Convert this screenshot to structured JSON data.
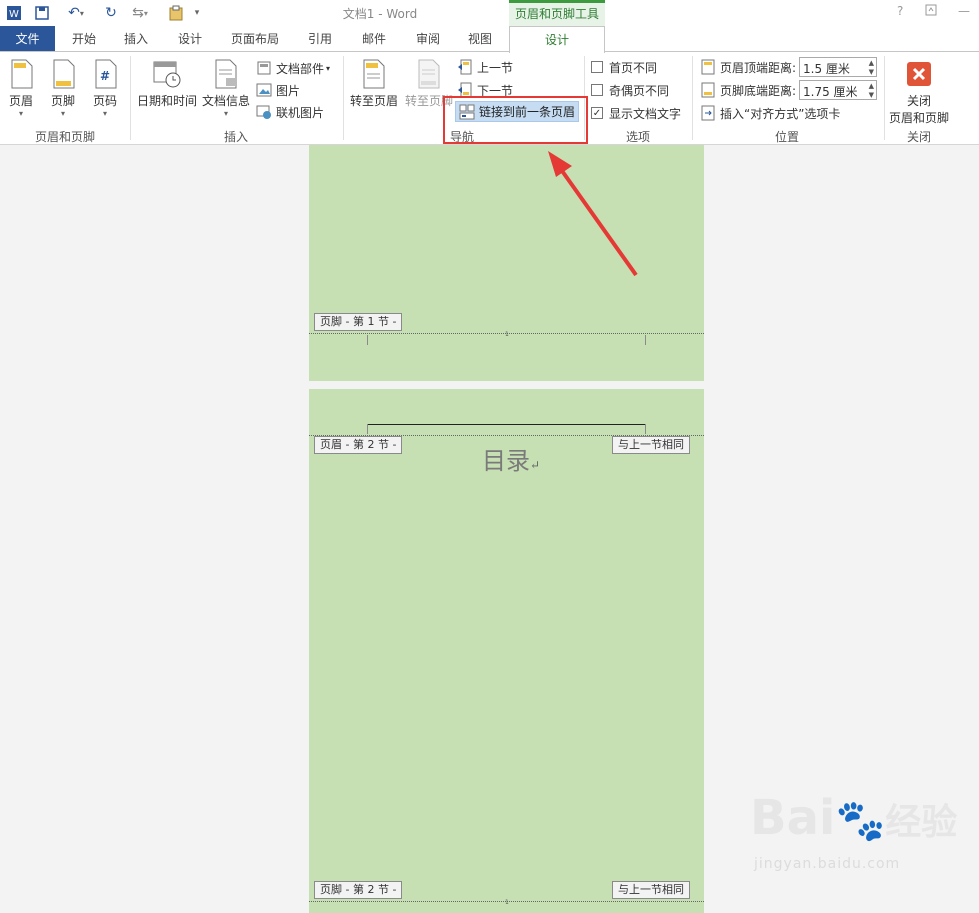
{
  "window": {
    "title": "文档1 - Word",
    "context_tab_group": "页眉和页脚工具",
    "help": "?",
    "accent_color": "#2b579a",
    "context_color": "#2e7d32"
  },
  "tabs": [
    "文件",
    "开始",
    "插入",
    "设计",
    "页面布局",
    "引用",
    "邮件",
    "审阅",
    "视图",
    "设计"
  ],
  "ribbon": {
    "groups": {
      "header_footer": {
        "label": "页眉和页脚",
        "header": "页眉",
        "footer": "页脚",
        "page_number": "页码"
      },
      "insert": {
        "label": "插入",
        "date_time": "日期和时间",
        "doc_info": "文档信息",
        "doc_parts": "文档部件",
        "picture": "图片",
        "online_picture": "联机图片"
      },
      "navigation": {
        "label": "导航",
        "goto_header": "转至页眉",
        "goto_footer": "转至页脚",
        "prev_section": "上一节",
        "next_section": "下一节",
        "link_to_previous": "链接到前一条页眉"
      },
      "options": {
        "label": "选项",
        "different_first": "首页不同",
        "different_odd_even": "奇偶页不同",
        "show_doc_text": "显示文档文字"
      },
      "position": {
        "label": "位置",
        "header_top_label": "页眉顶端距离:",
        "header_top_value": "1.5 厘米",
        "footer_bottom_label": "页脚底端距离:",
        "footer_bottom_value": "1.75 厘米",
        "insert_align_tab": "插入“对齐方式”选项卡"
      },
      "close": {
        "label": "关闭",
        "close_line1": "关闭",
        "close_line2": "页眉和页脚"
      }
    }
  },
  "document": {
    "footer_section1": "页脚 - 第 1 节 -",
    "header_section2": "页眉 - 第 2 节 -",
    "same_as_previous": "与上一节相同",
    "toc_title": "目录",
    "footer_section2": "页脚 - 第 2 节 -",
    "same_as_previous_2": "与上一节相同",
    "page_color": "#c6e0b4"
  },
  "watermark": {
    "brand": "Bai",
    "brand2": "经验",
    "url": "jingyan.baidu.com"
  }
}
